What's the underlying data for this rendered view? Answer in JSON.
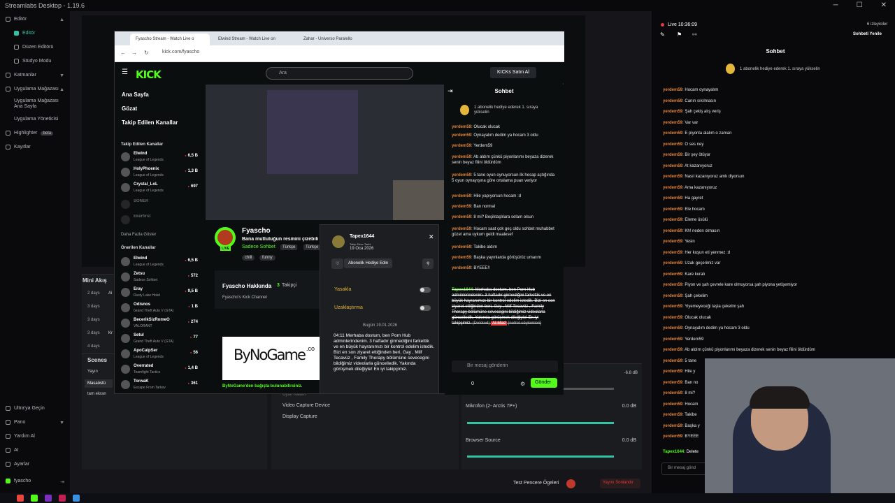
{
  "app": {
    "title": "Streamlabs Desktop - 1.19.6"
  },
  "window_controls": {
    "min": "─",
    "max": "☐",
    "close": "✕"
  },
  "sidebar": {
    "items": [
      {
        "label": "Editör",
        "active": false
      },
      {
        "label": "Editör",
        "active": true
      },
      {
        "label": "Düzen Editörü"
      },
      {
        "label": "Stüdyo Modu"
      },
      {
        "label": "Katmanlar"
      },
      {
        "label": "Uygulama Mağazası"
      },
      {
        "label": "Uygulama Mağazası Ana Sayfa"
      },
      {
        "label": "Uygulama Yöneticisi"
      },
      {
        "label": "Highlighter"
      },
      {
        "label": "Kayıtlar"
      }
    ],
    "beta": "beta",
    "bottom": [
      "Ultra'ya Geçin",
      "Pano",
      "Yardım Al",
      "AI",
      "Ayarlar"
    ],
    "user": "fyascho"
  },
  "studio": {
    "mini_feed_title": "Mini Akış",
    "feed_rows": [
      "2 days",
      "3 days",
      "3 days",
      "3 days",
      "4 days"
    ],
    "feed_trail": [
      "Ai",
      "",
      "",
      "Kr",
      ""
    ],
    "scenes_title": "Scenes",
    "scenes": [
      "Yayın",
      "Masaüstü",
      "tam ekran"
    ],
    "sources": [
      "Oyun Kaldırı",
      "Video Capture Device",
      "Display Capture"
    ],
    "mixer": [
      {
        "name": "Mikrofon (2- Arctis 7P+)",
        "db": "0.0 dB"
      },
      {
        "name": "Browser Source",
        "db": "0.0 dB"
      }
    ],
    "mixer_top_db": "-6.8 dB",
    "footer": {
      "test": "Test Pencere Ögeleri",
      "end": "Yayını Sonlandır"
    }
  },
  "browser": {
    "tabs": [
      "Fyascho Stream - Watch Live o",
      "Elwind Stream - Watch Live on",
      "Zahar - Universo Paralello"
    ],
    "url": "kick.com/fyascho"
  },
  "kick": {
    "logo": "KICK",
    "search_placeholder": "Ara",
    "buy": "KICKs Satın Al",
    "nav": [
      "Ana Sayfa",
      "Gözat",
      "Takip Edilen Kanallar"
    ],
    "followed_title": "Takip Edilen Kanallar",
    "followed": [
      {
        "name": "Elwind",
        "game": "League of Legends",
        "viewers": "6,5 B"
      },
      {
        "name": "HolyPhoenix",
        "game": "League of Legends",
        "viewers": "1,3 B"
      },
      {
        "name": "Crystal_LoL",
        "game": "League of Legends",
        "viewers": "697"
      },
      {
        "name": "SONER",
        "game": "",
        "viewers": ""
      },
      {
        "name": "Ekerfirst",
        "game": "",
        "viewers": ""
      }
    ],
    "more": "Daha Fazla Göster",
    "recommended_title": "Önerilen Kanallar",
    "recommended": [
      {
        "name": "Elwind",
        "game": "League of Legends",
        "viewers": "6,5 B"
      },
      {
        "name": "Zetsu",
        "game": "Sadece Sohbet",
        "viewers": "572"
      },
      {
        "name": "Eray",
        "game": "Rusty Lake Hotel",
        "viewers": "9,5 B"
      },
      {
        "name": "Odisnos",
        "game": "Grand Theft Auto V (GTA)",
        "viewers": "1 B"
      },
      {
        "name": "BecerikSizRomeO",
        "game": "VALORANT",
        "viewers": "274"
      },
      {
        "name": "Setul",
        "game": "Grand Theft Auto V (GTA)",
        "viewers": "77"
      },
      {
        "name": "ApoCalpSer",
        "game": "League of Legends",
        "viewers": "56"
      },
      {
        "name": "Overrated",
        "game": "Teamfight Tactics",
        "viewers": "1,4 B"
      },
      {
        "name": "TorwaK",
        "game": "Escape From Tarkov",
        "viewers": "361"
      }
    ],
    "streamer": {
      "name": "Fyascho",
      "title": "Bana mutluluğun resmini çizebili",
      "category": "Sadece Sohbet",
      "tags": [
        "Türkçe",
        "Türkçe"
      ],
      "chips": [
        "chill",
        "funny"
      ],
      "live": "LIVE"
    },
    "about": {
      "title": "Fyascho Hakkında",
      "followers": "3",
      "followers_label": "Takipçi",
      "desc": "Fyascho's Kick Channel"
    },
    "ad": {
      "brand": "ByNoGame",
      "suffix": ".co",
      "caption": "ByNoGame'den bağışta bulunabilirsiniz."
    }
  },
  "popup": {
    "user": "Tapex1644",
    "follow_label": "Takip Etme Tarihi",
    "follow_date": "19 Oca 2026",
    "gift": "Abonelik Hediye Edin",
    "ban": "Yasakla",
    "timeout": "Uzaklaştırma",
    "date_sep": "Bugün 19.01.2026",
    "time": "04:11",
    "message": "Merhaba dostum, ben Porn Hub adminlerindenim. 3 haftadır girmediğini farkettik ve en büyük hayranımızı bir kontrol edelim istedik. Bizi en son ziyaret ettiğinden beri, Gay , Milf Tecavüz , Family Therapy bölümüne sevecegini bildiğimiz videolarla güncelledik. Yakında görüşmek dileğiyle! En iyi takipçimiz."
  },
  "kick_chat": {
    "title": "Sohbet",
    "banner": "1 abonelik hediye ederek 1. sıraya yükselin",
    "messages": [
      {
        "u": "yerdem59",
        "t": "Olucak olucak"
      },
      {
        "u": "yerdem59",
        "t": "Oynayalım dedim ya hocam 3 oldu"
      },
      {
        "u": "yerdem59",
        "t": "Yerdem59"
      },
      {
        "u": "yerdem59",
        "t": "Ab aldım çünkü piyonlarımı beyaza dizerek senin beyaz filini öldürdüm"
      },
      {
        "u": "yerdem59",
        "t": "5 tane oyun oynuyorsun ilk hesap açtığında 5 oyun oynayışına göre ortalama puan veriyor"
      },
      {
        "u": "yerdem59",
        "t": "Hile yapıyorsun hocam :d"
      },
      {
        "u": "yerdem59",
        "t": "Ban normal"
      },
      {
        "u": "yerdem59",
        "t": "8 mi? Beşiktaşlılara selam olsun"
      },
      {
        "u": "yerdem59",
        "t": "Hocam saat çok geç oldu sohbet muhabbet güzel ama uykum geldi maalesef"
      },
      {
        "u": "yerdem59",
        "t": "Takibe aldım"
      },
      {
        "u": "yerdem59",
        "t": "Başka yayınlarda görüşürüz umarım"
      },
      {
        "u": "yerdem59",
        "t": "BYEEE!!"
      }
    ],
    "deleted_user": "Tapex1644",
    "deleted_text": "Merhaba dostum, ben Porn Hub adminlerindenim. 3 haftadır girmediğini farkettik ve en büyük hayranımızı bir kontrol edelim istedik. Bizi en son ziyaret ettiğinden beri, Gay , Milf Tecavüz , Family Therapy bölümüne sevecegini bildiğimiz videolarla güncelledik. Yakında görüşmek dileğiyle! En iyi takipçimiz.",
    "deleted_tag": "(Deleted)",
    "ai_mod": "AI Mod",
    "reason": "[nefret söylemleri]",
    "input_placeholder": "Bir mesaj gönderin",
    "count": "0",
    "send": "Gönder"
  },
  "right_chat": {
    "live": "Live 10:36:09",
    "viewers": "6 izleyiciler",
    "refresh": "Sohbeti Yenile",
    "title": "Sohbet",
    "banner": "1 abonelik hediye ederek 1. sıraya yükselin",
    "messages": [
      {
        "u": "yerdem59",
        "t": "Hocam oynayalım"
      },
      {
        "u": "yerdem59",
        "t": "Canın sıkılmasın"
      },
      {
        "u": "yerdem59",
        "t": "Şah çekiş alış veriş"
      },
      {
        "u": "yerdem59",
        "t": "Var var"
      },
      {
        "u": "yerdem59",
        "t": "E piyonla alalım o zaman"
      },
      {
        "u": "yerdem59",
        "t": "O ses ney"
      },
      {
        "u": "yerdem59",
        "t": "Bir şey ötüyor"
      },
      {
        "u": "yerdem59",
        "t": "At kazanıyoruz"
      },
      {
        "u": "yerdem59",
        "t": "Nasıl kazanıyoruz amk diyorsun"
      },
      {
        "u": "yerdem59",
        "t": "Ama kazanıyoruz"
      },
      {
        "u": "yerdem59",
        "t": "Ha gayret"
      },
      {
        "u": "yerdem59",
        "t": "Ele hocam"
      },
      {
        "u": "yerdem59",
        "t": "Eleme üsülü"
      },
      {
        "u": "yerdem59",
        "t": "Kh! neden olmasın"
      },
      {
        "u": "yerdem59",
        "t": "Yesin"
      },
      {
        "u": "yerdem59",
        "t": "Her kuşun eti yenmez :d"
      },
      {
        "u": "yerdem59",
        "t": "Uzak geçerimiz var"
      },
      {
        "u": "yerdem59",
        "t": "Kare kuralı"
      },
      {
        "u": "yerdem59",
        "t": "Piyon ve şah çevrele kare olmuyorsa şah piyona yetişemiyor"
      },
      {
        "u": "yerdem59",
        "t": "Şah çekelim"
      },
      {
        "u": "yerdem59",
        "t": "Yiyemeyeceği taşla çekelim şah"
      },
      {
        "u": "yerdem59",
        "t": "Olucak olucak"
      },
      {
        "u": "yerdem59",
        "t": "Oynayalım dedim ya hocam 3 oldu"
      },
      {
        "u": "yerdem59",
        "t": "Yerdem59"
      },
      {
        "u": "yerdem59",
        "t": "Ab aldım çünkü piyonlarımı beyaza dizerek senin beyaz filini öldürdüm"
      },
      {
        "u": "yerdem59",
        "t": "5 tane"
      },
      {
        "u": "yerdem59",
        "t": "Hile y"
      },
      {
        "u": "yerdem59",
        "t": "Ban no"
      },
      {
        "u": "yerdem59",
        "t": "8 mi?"
      },
      {
        "u": "yerdem59",
        "t": "Hocam"
      },
      {
        "u": "yerdem59",
        "t": "Takibe"
      },
      {
        "u": "yerdem59",
        "t": "Başka y"
      },
      {
        "u": "yerdem59",
        "t": "BYEEE"
      }
    ],
    "last_user": "Tapex1644",
    "last_text": "Delete",
    "input_placeholder": "Bir mesaj gönd"
  },
  "colors": {
    "kick_green": "#53fc18",
    "username": "#e2843a",
    "live_red": "#e5393b"
  }
}
